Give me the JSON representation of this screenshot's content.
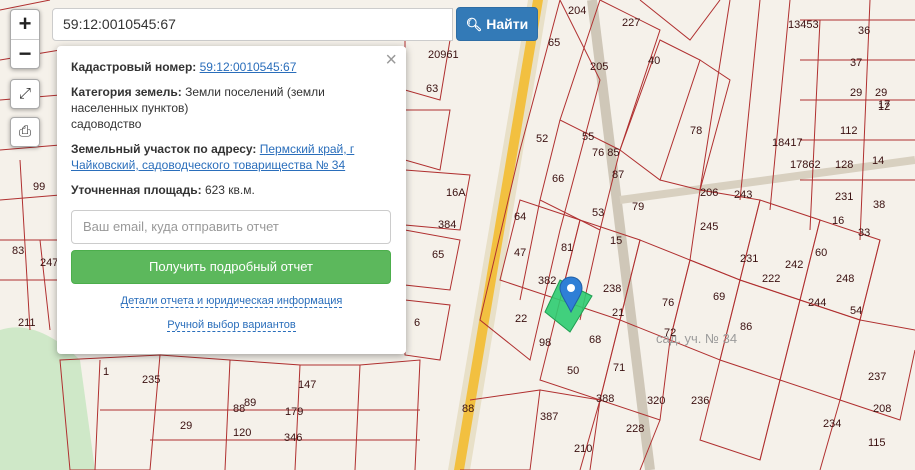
{
  "search": {
    "value": "59:12:0010545:67",
    "button_label": "Найти"
  },
  "controls": {
    "zoom_in": "+",
    "zoom_out": "−"
  },
  "popup": {
    "cad_label": "Кадастровый номер:",
    "cad_value": "59:12:0010545:67",
    "category_label": "Категория земель:",
    "category_value": "Земли поселений (земли населенных пунктов)",
    "usage": "садоводство",
    "address_label": "Земельный участок по адресу:",
    "address_value": "Пермский край, г Чайковский, садоводческого товарищества № 34",
    "area_label": "Уточненная площадь:",
    "area_value": "623 кв.м.",
    "email_placeholder": "Ваш email, куда отправить отчет",
    "report_button": "Получить подробный отчет",
    "details_link": "Детали отчета и юридическая информация",
    "manual_link": "Ручной выбор вариантов"
  },
  "map": {
    "parcel_labels": [
      "204",
      "227",
      "13453",
      "36",
      "29",
      "17",
      "65",
      "205",
      "40",
      "37",
      "20961",
      "63",
      "78",
      "18417",
      "29",
      "12",
      "112",
      "52",
      "55",
      "76 85",
      "17862",
      "128",
      "14",
      "88",
      "99",
      "66",
      "87",
      "206",
      "243",
      "231",
      "38",
      "16",
      "33",
      "16А",
      "64",
      "53",
      "81",
      "79",
      "245",
      "242",
      "60",
      "248",
      "83",
      "384",
      "65",
      "47",
      "15",
      "231",
      "222",
      "247",
      "382",
      "22",
      "21",
      "76",
      "69",
      "244",
      "54",
      "86",
      "211",
      "6",
      "98",
      "68",
      "72",
      "238",
      "1",
      "50",
      "71",
      "237",
      "235",
      "147",
      "88",
      "89",
      "179",
      "388",
      "236",
      "234",
      "208",
      "29",
      "120",
      "346",
      "387",
      "320",
      "228",
      "210",
      "115",
      "33"
    ],
    "area_label": "сад. уч. № 34",
    "colors": {
      "boundary": "#b03030",
      "road": "#f2c040",
      "parcel_fill": "#2ecc71",
      "marker": "#2f7fd6"
    }
  }
}
